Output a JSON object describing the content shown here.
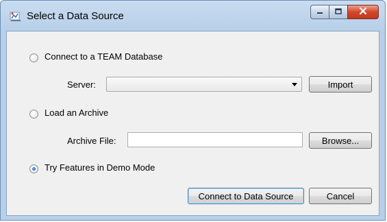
{
  "window": {
    "title": "Select a Data Source",
    "icon": "data-source-app-icon",
    "caption_buttons": [
      "minimize-icon",
      "maximize-icon",
      "close-icon"
    ]
  },
  "options": {
    "team_database": {
      "label": "Connect to a TEAM Database",
      "selected": false,
      "server_label": "Server:",
      "server_value": "",
      "import_label": "Import"
    },
    "archive": {
      "label": "Load an Archive",
      "selected": false,
      "file_label": "Archive File:",
      "file_value": "",
      "browse_label": "Browse..."
    },
    "demo": {
      "label": "Try Features in Demo Mode",
      "selected": true
    }
  },
  "footer": {
    "connect_label": "Connect to Data Source",
    "cancel_label": "Cancel"
  },
  "colors": {
    "title_gradient": "#c9dcf0",
    "client_bg": "#f0f0f0",
    "close_button": "#d2482d",
    "radio_dot": "#1c5fa8"
  }
}
